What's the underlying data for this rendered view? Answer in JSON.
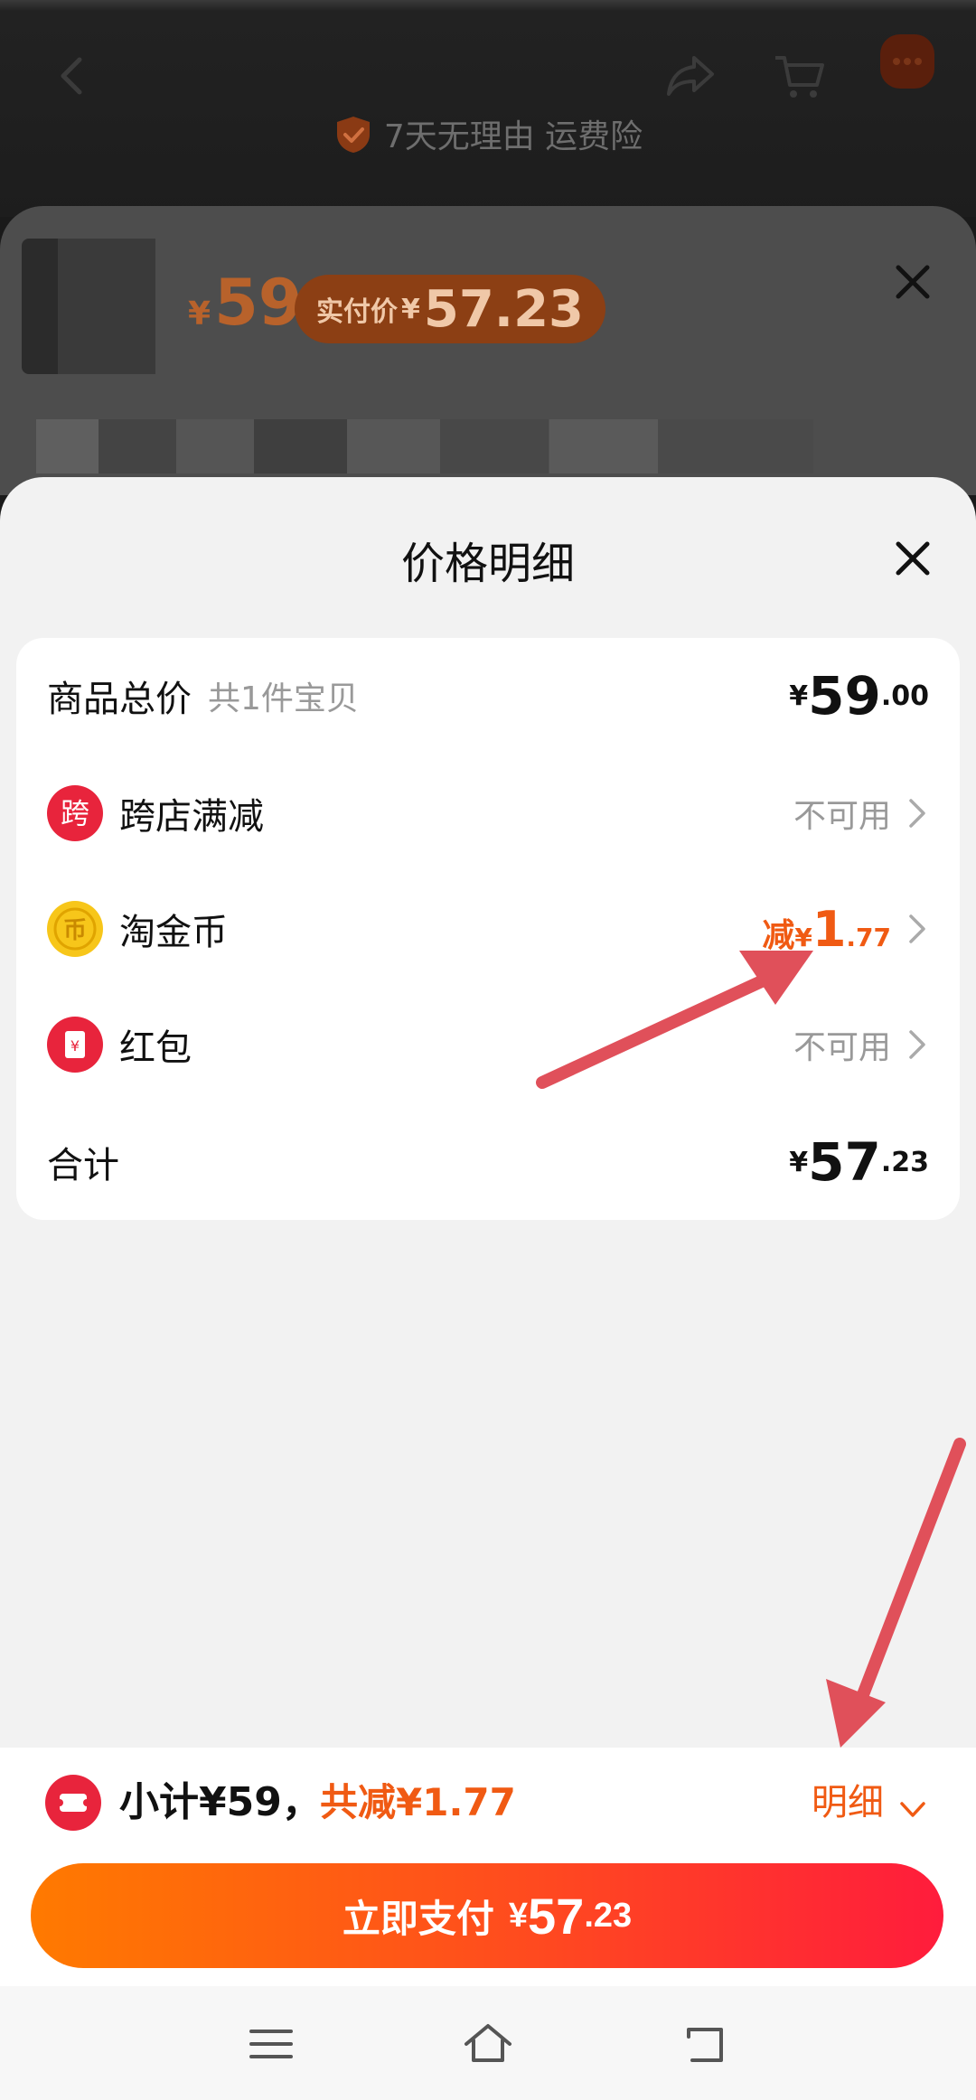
{
  "header": {
    "guarantee_text": "7天无理由 运费险",
    "icons": [
      "back-icon",
      "share-icon",
      "cart-icon",
      "more-icon",
      "shield-check-icon"
    ]
  },
  "product": {
    "price_yen": "¥",
    "price": "59",
    "real_price_label": "实付价",
    "real_price_yen": "¥",
    "real_price_value": "57.23"
  },
  "sheet": {
    "title": "价格明细",
    "rows": {
      "total": {
        "label": "商品总价",
        "sublabel": "共1件宝贝",
        "yen": "¥",
        "int": "59",
        "dec": ".00"
      },
      "cross_store": {
        "label": "跨店满减",
        "icon_char": "跨",
        "value": "不可用"
      },
      "coins": {
        "label": "淘金币",
        "icon_char": "币",
        "prefix": "减",
        "yen": "¥",
        "int": "1",
        "dec": ".77"
      },
      "red_packet": {
        "label": "红包",
        "icon_char": "¥",
        "value": "不可用"
      },
      "sum": {
        "label": "合计",
        "yen": "¥",
        "int": "57",
        "dec": ".23"
      }
    }
  },
  "bottom": {
    "subtotal": "小计¥59，",
    "discount": "共减¥1.77",
    "details_label": "明细",
    "pay": {
      "label": "立即支付",
      "yen": "¥",
      "int": "57",
      "dec": ".23"
    }
  },
  "colors": {
    "accent": "#f05a13",
    "pay_gradient_start": "#ff7a00",
    "pay_gradient_end": "#ff1c3c",
    "icon_red": "#e8243c",
    "coin_gold": "#f7c61a",
    "annotation_arrow": "#e0505a"
  }
}
